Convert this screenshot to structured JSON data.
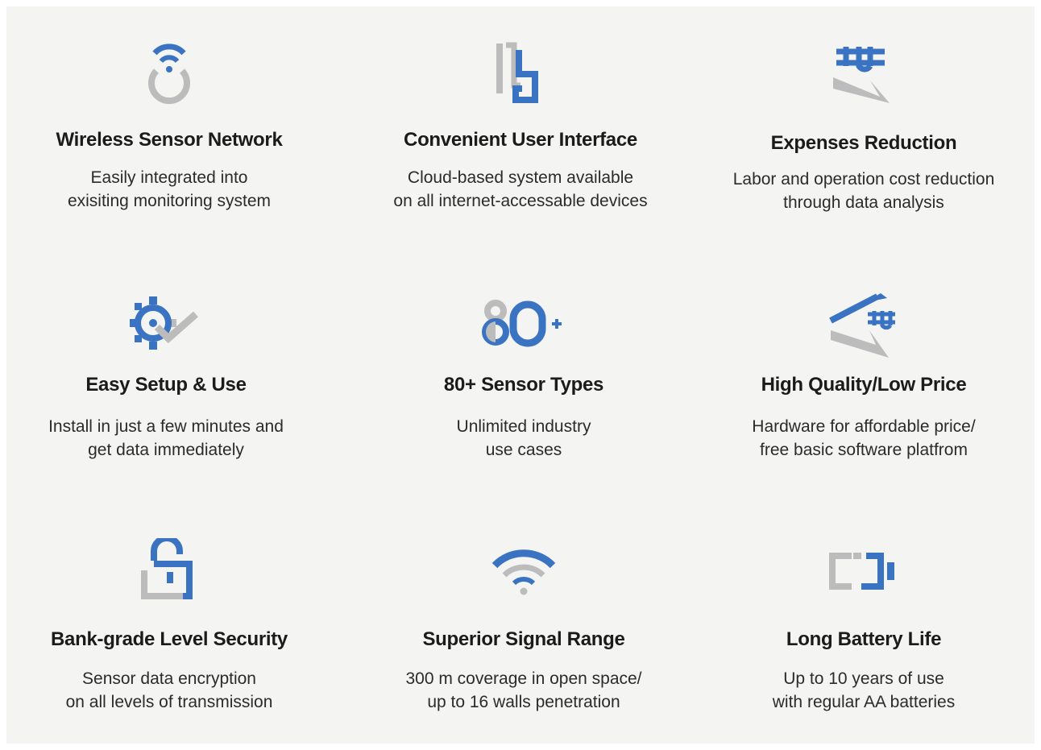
{
  "colors": {
    "blue": "#3a73c2",
    "gray": "#bcbcbc",
    "background": "#f4f4f3",
    "text": "#1b1b1b"
  },
  "features": [
    {
      "icon": "wireless-sensor-icon",
      "title": "Wireless Sensor Network",
      "desc": [
        "Easily integrated into",
        "exisiting monitoring system"
      ]
    },
    {
      "icon": "user-interface-icon",
      "title": "Convenient User Interface",
      "desc": [
        "Cloud-based system available",
        "on all internet-accessable devices"
      ]
    },
    {
      "icon": "expenses-reduction-icon",
      "title": "Expenses Reduction",
      "desc": [
        "Labor and operation cost reduction",
        "through data analysis"
      ]
    },
    {
      "icon": "gear-check-icon",
      "title": "Easy Setup & Use",
      "desc": [
        "Install in just a few minutes and",
        "get data immediately"
      ]
    },
    {
      "icon": "eighty-plus-icon",
      "icon_text": "80+",
      "title": "80+ Sensor Types",
      "desc": [
        "Unlimited industry",
        "use cases"
      ]
    },
    {
      "icon": "quality-price-icon",
      "title": "High Quality/Low Price",
      "desc": [
        "Hardware for affordable price/",
        "free basic software platfrom"
      ]
    },
    {
      "icon": "lock-icon",
      "title": "Bank-grade Level Security",
      "desc": [
        "Sensor data encryption",
        "on all levels of transmission"
      ]
    },
    {
      "icon": "wifi-icon",
      "title": "Superior Signal Range",
      "desc": [
        "300 m coverage in open space/",
        "up to 16 walls penetration"
      ]
    },
    {
      "icon": "battery-icon",
      "title": "Long Battery Life",
      "desc": [
        "Up to 10 years of use",
        "with regular AA batteries"
      ]
    }
  ]
}
